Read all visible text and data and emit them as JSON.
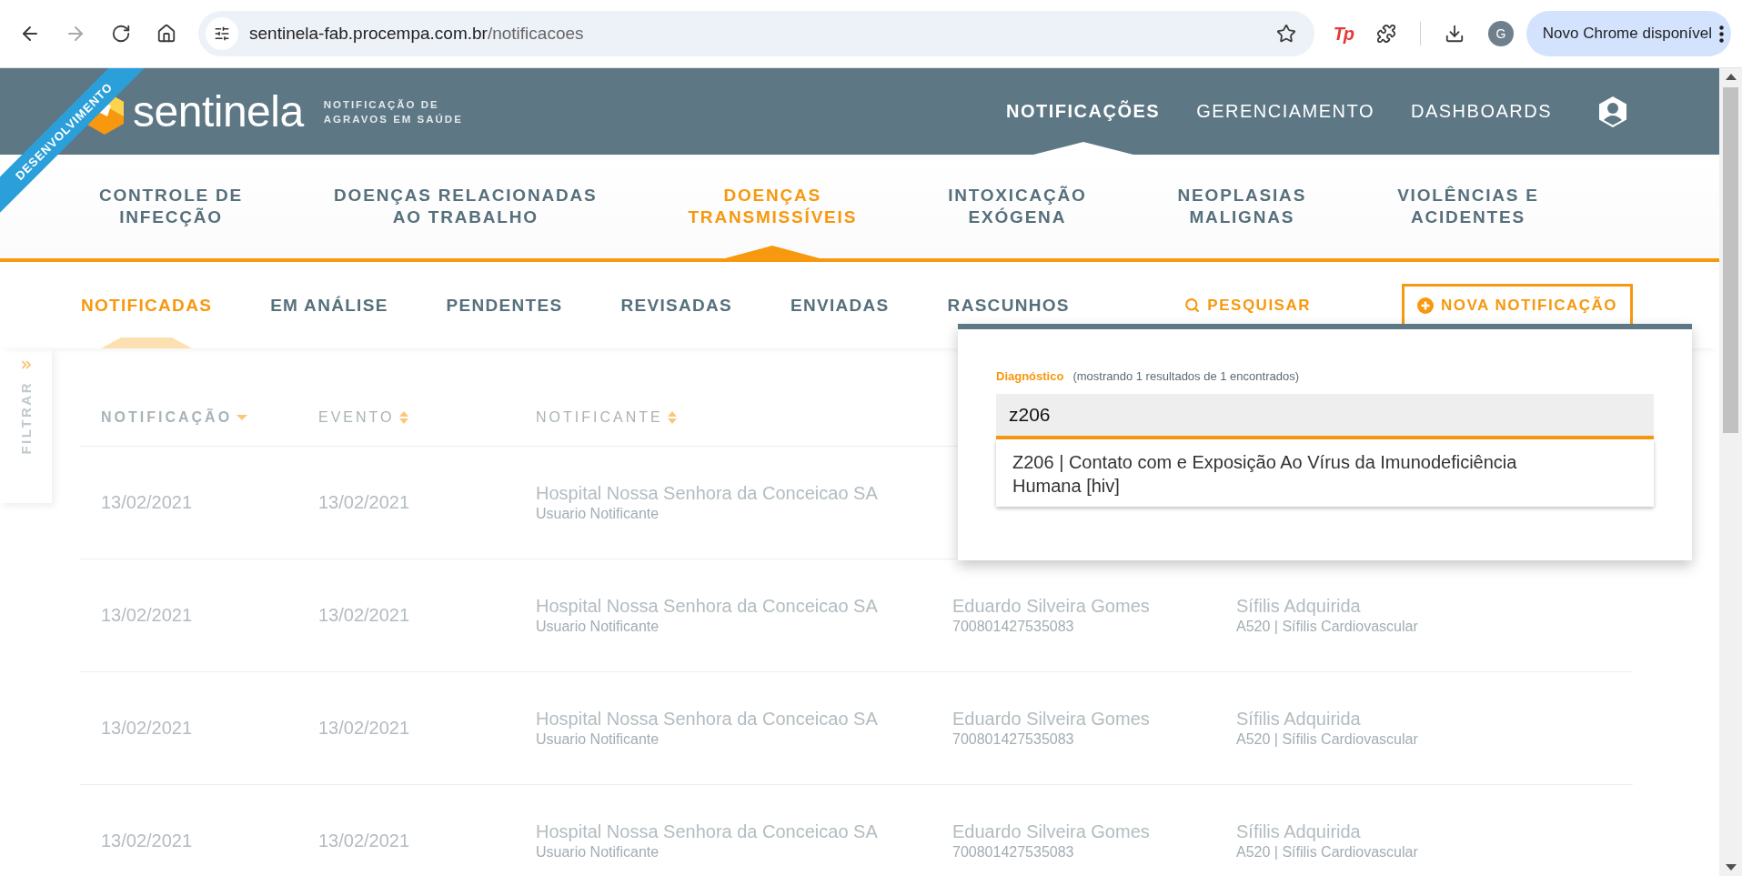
{
  "browser": {
    "url_host": "sentinela-fab.procempa.com.br",
    "url_path": "/notificacoes",
    "forward_disabled": true,
    "extension_label": "Tp",
    "profile_initial": "G",
    "update_label": "Novo Chrome disponível"
  },
  "ribbon": "DESENVOLVIMENTO",
  "brand": {
    "name": "sentinela",
    "tagline": [
      "NOTIFICAÇÃO DE",
      "AGRAVOS EM SAÚDE"
    ]
  },
  "main_nav": [
    {
      "label": "NOTIFICAÇÕES",
      "selected": true
    },
    {
      "label": "GERENCIAMENTO",
      "selected": false
    },
    {
      "label": "DASHBOARDS",
      "selected": false
    }
  ],
  "categories": [
    {
      "lines": [
        "CONTROLE DE",
        "INFECÇÃO"
      ],
      "selected": false
    },
    {
      "lines": [
        "DOENÇAS RELACIONADAS",
        "AO TRABALHO"
      ],
      "selected": false
    },
    {
      "lines": [
        "DOENÇAS",
        "TRANSMISSÍVEIS"
      ],
      "selected": true
    },
    {
      "lines": [
        "INTOXICAÇÃO",
        "EXÓGENA"
      ],
      "selected": false
    },
    {
      "lines": [
        "NEOPLASIAS",
        "MALIGNAS"
      ],
      "selected": false
    },
    {
      "lines": [
        "VIOLÊNCIAS E",
        "ACIDENTES"
      ],
      "selected": false
    }
  ],
  "subtabs": [
    {
      "label": "NOTIFICADAS",
      "selected": true
    },
    {
      "label": "EM ANÁLISE",
      "selected": false
    },
    {
      "label": "PENDENTES",
      "selected": false
    },
    {
      "label": "REVISADAS",
      "selected": false
    },
    {
      "label": "ENVIADAS",
      "selected": false
    },
    {
      "label": "RASCUNHOS",
      "selected": false
    }
  ],
  "actions": {
    "search": "PESQUISAR",
    "new": "NOVA NOTIFICAÇÃO"
  },
  "filter_tab": {
    "label": "FILTRAR"
  },
  "table": {
    "columns": [
      {
        "label": "NOTIFICAÇÃO",
        "sorted": true
      },
      {
        "label": "EVENTO",
        "sorted": false
      },
      {
        "label": "NOTIFICANTE",
        "sorted": false
      }
    ],
    "rows": [
      {
        "notificacao": "13/02/2021",
        "evento": "13/02/2021",
        "notificante": {
          "name": "Hospital Nossa Senhora da Conceicao SA",
          "role": "Usuario Notificante"
        }
      },
      {
        "notificacao": "13/02/2021",
        "evento": "13/02/2021",
        "notificante": {
          "name": "Hospital Nossa Senhora da Conceicao SA",
          "role": "Usuario Notificante"
        },
        "column_4": {
          "main": "Eduardo Silveira Gomes",
          "sub": "700801427535083"
        },
        "column_5": {
          "main": "Sífilis Adquirida",
          "sub": "A520 | Sífilis Cardiovascular"
        }
      },
      {
        "notificacao": "13/02/2021",
        "evento": "13/02/2021",
        "notificante": {
          "name": "Hospital Nossa Senhora da Conceicao SA",
          "role": "Usuario Notificante"
        },
        "column_4": {
          "main": "Eduardo Silveira Gomes",
          "sub": "700801427535083"
        },
        "column_5": {
          "main": "Sífilis Adquirida",
          "sub": "A520 | Sífilis Cardiovascular"
        }
      },
      {
        "notificacao": "13/02/2021",
        "evento": "13/02/2021",
        "notificante": {
          "name": "Hospital Nossa Senhora da Conceicao SA",
          "role": "Usuario Notificante"
        },
        "column_4": {
          "main": "Eduardo Silveira Gomes",
          "sub": "700801427535083"
        },
        "column_5": {
          "main": "Sífilis Adquirida",
          "sub": "A520 | Sífilis Cardiovascular"
        }
      }
    ]
  },
  "diagnosis_popup": {
    "label": "Diagnóstico",
    "hint": "(mostrando 1 resultados de 1 encontrados)",
    "value": "z206",
    "suggestions": [
      {
        "text": "Z206 | Contato com e Exposição Ao Vírus da Imunodeficiência Humana [hiv]"
      }
    ]
  }
}
